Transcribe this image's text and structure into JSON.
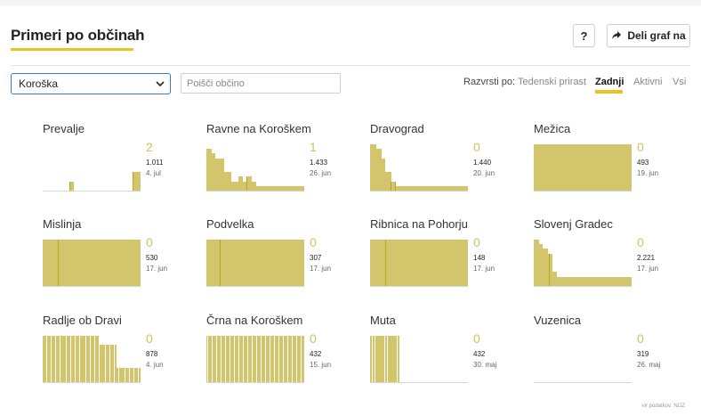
{
  "header": {
    "title": "Primeri po občinah",
    "help_label": "?",
    "share_label": "Deli graf na"
  },
  "filters": {
    "region_value": "Koroška",
    "search_placeholder": "Poišči občino",
    "sort_label": "Razvrsti po:",
    "sort_options": [
      {
        "label": "Tedenski prirast",
        "active": false
      },
      {
        "label": "Zadnji",
        "active": true
      },
      {
        "label": "Aktivni",
        "active": false
      },
      {
        "label": "Vsi",
        "active": false
      }
    ]
  },
  "colors": {
    "accent": "#e8c51a",
    "bar": "#d3c56b",
    "bar_dark": "#b9a521",
    "value": "#d2c060",
    "focus": "#3a78c8"
  },
  "icons": {
    "share": "share-arrow-icon",
    "select": "chevron-down-icon"
  },
  "tiles": [
    {
      "name": "Prevalje",
      "value": "2",
      "total": "1.011",
      "date": "4. jul",
      "bars": [
        0,
        0,
        0,
        0,
        0,
        0,
        0,
        0,
        0,
        0,
        0,
        0,
        0,
        0,
        0,
        0,
        0,
        0,
        0,
        0,
        0,
        0,
        0,
        0,
        0,
        0,
        0,
        0,
        0,
        0,
        0,
        0,
        0,
        0,
        0,
        0,
        0,
        0,
        0,
        0,
        0,
        0,
        0,
        2,
        2,
        2,
        2,
        2,
        2,
        2,
        0,
        0,
        0,
        0,
        0,
        0,
        0,
        0,
        0,
        0,
        0,
        0,
        0,
        0,
        0,
        0,
        0,
        0,
        0,
        0,
        0,
        0,
        0,
        0,
        0,
        0,
        0,
        0,
        0,
        0,
        0,
        0,
        0,
        0,
        0,
        0,
        0,
        0,
        0,
        0,
        0,
        0,
        0,
        0,
        0,
        0,
        0,
        0,
        0,
        0,
        0,
        0,
        0,
        0,
        0,
        0,
        0,
        0,
        0,
        0,
        0,
        0,
        0,
        0,
        0,
        0,
        0,
        0,
        0,
        0,
        0,
        0,
        0,
        0,
        0,
        0,
        0,
        0,
        0,
        0,
        0,
        0,
        0,
        0,
        0,
        0,
        0,
        0,
        0,
        0,
        0,
        0,
        0,
        0,
        4,
        4,
        4,
        4,
        4,
        4,
        4,
        4,
        4,
        4,
        4,
        4,
        4
      ],
      "dark": [
        43,
        144
      ]
    },
    {
      "name": "Ravne na Koroškem",
      "value": "1",
      "total": "1.433",
      "date": "26. jun",
      "bars": [
        9,
        9,
        9,
        9,
        9,
        9,
        9,
        9,
        8,
        8,
        8,
        8,
        8,
        7,
        7,
        7,
        7,
        7,
        7,
        7,
        7,
        7,
        7,
        7,
        7,
        7,
        7,
        4,
        4,
        4,
        4,
        4,
        4,
        4,
        4,
        4,
        4,
        4,
        2,
        2,
        2,
        2,
        2,
        2,
        2,
        2,
        2,
        2,
        2,
        3,
        3,
        3,
        3,
        3,
        3,
        3,
        2,
        2,
        2,
        2,
        2,
        2,
        3,
        3,
        3,
        3,
        3,
        3,
        3,
        2,
        2,
        2,
        2,
        2,
        2,
        2,
        1,
        1,
        1,
        1,
        1,
        1,
        1,
        1,
        1,
        1,
        1,
        1,
        1,
        1,
        1,
        1,
        1,
        1,
        1,
        1,
        1,
        1,
        1,
        1,
        1,
        1,
        1,
        1,
        1,
        1,
        1,
        1,
        1,
        1,
        1,
        1,
        1,
        1,
        1,
        1,
        1,
        1,
        1,
        1,
        1,
        1,
        1,
        1,
        1,
        1,
        1,
        1,
        1,
        1,
        1,
        1,
        1,
        1,
        1,
        1,
        1,
        1,
        1,
        1,
        1,
        1,
        1,
        1,
        1,
        1,
        1,
        1,
        1,
        1,
        1
      ],
      "dark": [
        49,
        62
      ]
    },
    {
      "name": "Dravograd",
      "value": "0",
      "total": "1.440",
      "date": "20. jun",
      "bars": [
        10,
        10,
        10,
        10,
        10,
        10,
        10,
        10,
        10,
        9,
        9,
        9,
        9,
        9,
        9,
        9,
        9,
        9,
        7,
        7,
        7,
        7,
        7,
        7,
        4,
        4,
        4,
        4,
        4,
        4,
        4,
        4,
        4,
        2,
        2,
        2,
        2,
        2,
        2,
        2,
        2,
        1,
        1,
        1,
        1,
        1,
        1,
        1,
        1,
        1,
        1,
        1,
        1,
        1,
        1,
        1,
        1,
        1,
        1,
        1,
        1,
        1,
        1,
        1,
        1,
        1,
        1,
        1,
        1,
        1,
        1,
        1,
        1,
        1,
        1,
        1,
        1,
        1,
        1,
        1,
        1,
        1,
        1,
        1,
        1,
        1,
        1,
        1,
        1,
        1,
        1,
        1,
        1,
        1,
        1,
        1,
        1,
        1,
        1,
        1,
        1,
        1,
        1,
        1,
        1,
        1,
        1,
        1,
        1,
        1,
        1,
        1,
        1,
        1,
        1,
        1,
        1,
        1,
        1,
        1,
        1,
        1,
        1,
        1,
        1,
        1,
        1,
        1,
        1,
        1,
        1,
        1,
        1,
        1,
        1,
        1,
        1,
        1,
        1,
        1,
        1,
        1,
        1,
        1,
        1,
        1,
        1,
        1,
        1,
        1,
        1,
        1,
        1,
        1,
        1,
        1
      ],
      "dark": [
        33,
        40
      ]
    },
    {
      "name": "Mežica",
      "value": "0",
      "total": "493",
      "date": "19. jun",
      "bars": [
        10,
        10,
        10,
        10,
        10,
        10,
        10,
        10,
        10,
        10,
        10,
        10,
        10,
        10,
        10,
        10,
        10,
        10,
        10,
        10,
        10,
        10,
        10,
        10,
        10,
        10,
        10,
        10,
        10,
        10,
        10,
        10,
        10,
        10,
        10,
        10,
        10,
        10,
        10,
        10,
        10,
        10,
        10,
        10,
        10,
        10,
        10,
        10,
        10,
        10,
        10,
        10,
        10,
        10,
        10,
        10,
        10,
        10,
        10,
        10,
        10,
        10,
        10,
        10,
        10,
        10,
        10,
        10,
        10,
        10,
        10,
        10,
        10,
        10,
        10,
        10,
        10,
        10,
        10,
        10,
        10,
        10,
        10,
        10,
        10,
        10,
        10,
        10,
        10,
        10,
        10,
        10,
        10,
        10,
        10,
        10,
        10,
        10,
        10,
        10,
        10,
        10,
        10,
        10,
        10,
        10,
        10,
        10,
        10,
        10,
        10,
        10,
        10,
        10,
        10,
        10,
        10,
        10,
        10,
        10,
        10,
        10,
        10,
        10,
        10,
        10,
        10,
        10,
        10,
        10,
        10,
        10,
        10,
        10,
        10,
        10,
        10,
        10,
        10,
        10,
        10,
        10,
        10,
        10,
        10,
        10,
        10,
        10,
        10,
        10,
        10,
        10,
        10,
        10,
        10,
        10
      ],
      "dark": [
        28
      ]
    },
    {
      "name": "Mislinja",
      "value": "0",
      "total": "530",
      "date": "17. jun",
      "bars": [
        10,
        10,
        10,
        10,
        10,
        10,
        10,
        10,
        10,
        10,
        10,
        10,
        10,
        10,
        10,
        10,
        10,
        10,
        10,
        10,
        10,
        10,
        10,
        10,
        10,
        10,
        10,
        10,
        10,
        10,
        10,
        10,
        10,
        10,
        10,
        10,
        10,
        10,
        10,
        10,
        10,
        10,
        10,
        10,
        10,
        10,
        10,
        10,
        10,
        10,
        10,
        10,
        10,
        10,
        10,
        10,
        10,
        10,
        10,
        10,
        10,
        10,
        10,
        10,
        10,
        10,
        10,
        10,
        10,
        10,
        10,
        10,
        10,
        10,
        10,
        10,
        10,
        10,
        10,
        10,
        10,
        10,
        10,
        10,
        10,
        10,
        10,
        10,
        10,
        10,
        10,
        10,
        10,
        10,
        10,
        10,
        10,
        10,
        10,
        10,
        10,
        10,
        10,
        10,
        10,
        10,
        10,
        10,
        10,
        10,
        10,
        10,
        10,
        10,
        10,
        10,
        10,
        10,
        10,
        10,
        10,
        10,
        10,
        10,
        10,
        10,
        10,
        10,
        10,
        10,
        10,
        10,
        10,
        10,
        10,
        10,
        10,
        10,
        10,
        10,
        10,
        10,
        10,
        10,
        10,
        10,
        10,
        10,
        10,
        10,
        10,
        10,
        10,
        10
      ],
      "dark": [
        24
      ]
    },
    {
      "name": "Podvelka",
      "value": "0",
      "total": "307",
      "date": "17. jun",
      "bars": [
        10,
        10,
        10,
        10,
        10,
        10,
        10,
        10,
        10,
        10,
        10,
        10,
        10,
        10,
        10,
        10,
        10,
        10,
        10,
        10,
        10,
        10,
        10,
        10,
        10,
        10,
        10,
        10,
        10,
        10,
        10,
        10,
        10,
        10,
        10,
        10,
        10,
        10,
        10,
        10,
        10,
        10,
        10,
        10,
        10,
        10,
        10,
        10,
        10,
        10,
        10,
        10,
        10,
        10,
        10,
        10,
        10,
        10,
        10,
        10,
        10,
        10,
        10,
        10,
        10,
        10,
        10,
        10,
        10,
        10,
        10,
        10,
        10,
        10,
        10,
        10,
        10,
        10,
        10,
        10,
        10,
        10,
        10,
        10,
        10,
        10,
        10,
        10,
        10,
        10,
        10,
        10,
        10,
        10,
        10,
        10,
        10,
        10,
        10,
        10,
        10,
        10,
        10,
        10,
        10,
        10,
        10,
        10,
        10,
        10,
        10,
        10,
        10,
        10,
        10,
        10,
        10,
        10,
        10,
        10,
        10,
        10,
        10,
        10,
        10,
        10,
        10,
        10,
        10,
        10,
        10,
        10,
        10,
        10,
        10,
        10,
        10,
        10,
        10,
        10,
        10,
        10,
        10,
        10,
        10,
        10,
        10,
        10,
        10,
        10,
        10,
        10,
        10,
        10,
        10,
        10
      ],
      "dark": [
        21
      ]
    },
    {
      "name": "Ribnica na Pohorju",
      "value": "0",
      "total": "148",
      "date": "17. jun",
      "bars": [
        10,
        10,
        10,
        10,
        10,
        10,
        10,
        10,
        10,
        10,
        10,
        10,
        10,
        10,
        10,
        10,
        10,
        10,
        10,
        10,
        10,
        10,
        10,
        10,
        10,
        10,
        10,
        10,
        10,
        10,
        10,
        10,
        10,
        10,
        10,
        10,
        10,
        10,
        10,
        10,
        10,
        10,
        10,
        10,
        10,
        10,
        10,
        10,
        10,
        10,
        10,
        10,
        10,
        10,
        10,
        10,
        10,
        10,
        10,
        10,
        10,
        10,
        10,
        10,
        10,
        10,
        10,
        10,
        10,
        10,
        10,
        10,
        10,
        10,
        10,
        10,
        10,
        10,
        10,
        10,
        10,
        10,
        10,
        10,
        10,
        10,
        10,
        10,
        10,
        10,
        10,
        10,
        10,
        10,
        10,
        10,
        10,
        10,
        10,
        10,
        10,
        10,
        10,
        10,
        10,
        10,
        10,
        10,
        10,
        10,
        10,
        10,
        10,
        10,
        10,
        10,
        10,
        10,
        10,
        10,
        10,
        10,
        10,
        10,
        10,
        10,
        10,
        10,
        10,
        10,
        10,
        10,
        10,
        10,
        10,
        10,
        10,
        10,
        10,
        10,
        10,
        10,
        10,
        10,
        10,
        10,
        10,
        10,
        10,
        10,
        10,
        10,
        10,
        10,
        10
      ],
      "dark": [
        24
      ]
    },
    {
      "name": "Slovenj Gradec",
      "value": "0",
      "total": "2.221",
      "date": "17. jun",
      "bars": [
        10,
        10,
        10,
        10,
        10,
        10,
        10,
        10,
        9,
        9,
        9,
        9,
        9,
        9,
        8,
        8,
        8,
        8,
        8,
        8,
        8,
        8,
        7,
        7,
        7,
        7,
        7,
        7,
        7,
        7,
        3,
        3,
        3,
        3,
        3,
        3,
        3,
        2,
        2,
        2,
        2,
        2,
        2,
        2,
        2,
        2,
        2,
        2,
        2,
        2,
        2,
        2,
        2,
        2,
        2,
        2,
        2,
        2,
        2,
        2,
        2,
        2,
        2,
        2,
        2,
        2,
        2,
        2,
        2,
        2,
        2,
        2,
        2,
        2,
        2,
        2,
        2,
        2,
        2,
        2,
        2,
        2,
        2,
        2,
        2,
        2,
        2,
        2,
        2,
        2,
        2,
        2,
        2,
        2,
        2,
        2,
        2,
        2,
        2,
        2,
        2,
        2,
        2,
        2,
        2,
        2,
        2,
        2,
        2,
        2,
        2,
        2,
        2,
        2,
        2,
        2,
        2,
        2,
        2,
        2,
        2,
        2,
        2,
        2,
        2,
        2,
        2,
        2,
        2,
        2,
        2,
        2,
        2,
        2,
        2,
        2,
        2,
        2,
        2,
        2,
        2,
        2,
        2,
        2,
        2,
        2,
        2,
        2,
        2,
        2,
        2,
        2,
        2,
        2,
        2,
        2
      ],
      "dark": [
        24
      ]
    },
    {
      "name": "Radlje ob Dravi",
      "value": "0",
      "total": "878",
      "date": "4. jun",
      "bars": [
        10,
        10,
        10,
        10,
        10,
        10,
        10,
        10,
        10,
        10,
        10,
        10,
        10,
        10,
        10,
        10,
        10,
        10,
        10,
        10,
        10,
        10,
        10,
        10,
        10,
        10,
        8,
        8,
        8,
        8,
        8,
        8,
        8,
        8,
        3,
        3,
        3,
        3,
        3,
        3,
        3,
        3,
        3,
        3,
        3
      ],
      "dark": []
    },
    {
      "name": "Črna na Koroškem",
      "value": "0",
      "total": "432",
      "date": "15. jun",
      "bars": [
        10,
        10,
        10,
        10,
        10,
        10,
        10,
        10,
        10,
        10,
        10,
        10,
        10,
        10,
        10,
        10,
        10,
        10,
        10,
        10,
        10,
        10,
        10,
        10,
        10,
        10,
        10,
        10,
        10,
        10,
        10,
        10,
        10,
        10,
        10,
        10,
        10,
        10,
        10,
        10,
        10,
        10,
        10,
        10,
        10,
        10,
        10,
        10,
        10,
        10,
        10,
        10,
        10,
        10,
        10,
        10,
        10,
        10,
        10,
        10,
        10,
        10,
        10,
        10,
        10,
        10
      ],
      "dark": []
    },
    {
      "name": "Muta",
      "value": "0",
      "total": "432",
      "date": "30. maj",
      "bars": [
        10,
        10,
        10,
        10,
        10,
        10,
        10,
        10,
        10,
        10,
        10,
        10
      ],
      "dark": []
    },
    {
      "name": "Vuzenica",
      "value": "0",
      "total": "319",
      "date": "26. maj",
      "bars": [],
      "dark": []
    }
  ],
  "footer": {
    "source": "vir podatkov: NIJZ"
  }
}
